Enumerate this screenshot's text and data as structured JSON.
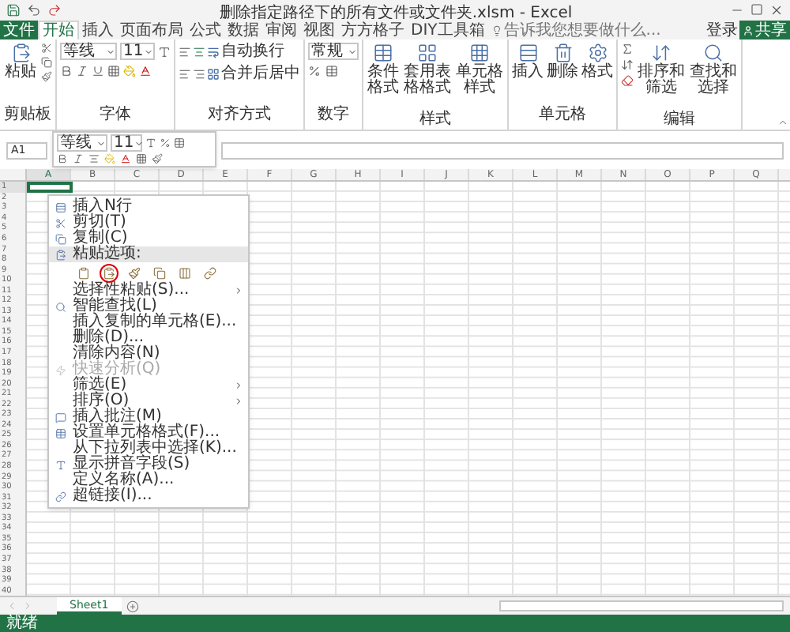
{
  "window": {
    "title": "删除指定路径下的所有文件或文件夹.xlsm - Excel"
  },
  "ribbon_tabs": [
    {
      "label": "文件",
      "kind": "file",
      "selected": false
    },
    {
      "label": "开始",
      "kind": "tab",
      "selected": true
    },
    {
      "label": "插入",
      "kind": "tab",
      "selected": false
    },
    {
      "label": "页面布局",
      "kind": "tab",
      "selected": false
    },
    {
      "label": "公式",
      "kind": "tab",
      "selected": false
    },
    {
      "label": "数据",
      "kind": "tab",
      "selected": false
    },
    {
      "label": "审阅",
      "kind": "tab",
      "selected": false
    },
    {
      "label": "视图",
      "kind": "tab",
      "selected": false
    },
    {
      "label": "方方格子",
      "kind": "tab",
      "selected": false
    },
    {
      "label": "DIY工具箱",
      "kind": "tab",
      "selected": false
    }
  ],
  "search": {
    "placeholder": "告诉我您想要做什么..."
  },
  "account": {
    "sign_in": "登录",
    "share": "共享"
  },
  "ribbon": {
    "clipboard": {
      "label": "剪贴板",
      "paste": "粘贴"
    },
    "font": {
      "label": "字体",
      "font_name": "等线",
      "font_size": "11"
    },
    "alignment": {
      "label": "对齐方式",
      "wrap_text": "自动换行",
      "merge_center": "合并后居中"
    },
    "number": {
      "label": "数字",
      "format": "常规"
    },
    "styles": {
      "label": "样式",
      "buttons": [
        "条件格式",
        "套用表格格式",
        "单元格样式"
      ]
    },
    "cells": {
      "label": "单元格",
      "buttons": [
        "插入",
        "删除",
        "格式"
      ]
    },
    "editing": {
      "label": "编辑",
      "buttons": [
        "排序和筛选",
        "查找和选择"
      ]
    }
  },
  "formula_bar": {
    "name_box": "A1"
  },
  "mini_toolbar": {
    "font_name": "等线",
    "font_size": "11"
  },
  "columns": [
    "A",
    "B",
    "C",
    "D",
    "E",
    "F",
    "G",
    "H",
    "I",
    "J",
    "K",
    "L",
    "M",
    "N",
    "O",
    "P",
    "Q"
  ],
  "rows": [
    "1",
    "2",
    "3",
    "4",
    "5",
    "6",
    "7",
    "8",
    "9",
    "10",
    "11",
    "12",
    "13",
    "14",
    "15",
    "16",
    "17",
    "18",
    "19",
    "20",
    "21",
    "22",
    "23",
    "24",
    "25",
    "26",
    "27",
    "28",
    "29",
    "30",
    "31",
    "32",
    "33",
    "34",
    "35",
    "36",
    "37",
    "38",
    "39",
    "40"
  ],
  "context_menu": {
    "items": [
      {
        "kind": "item",
        "label": "插入N行",
        "disabled": false,
        "submenu": false,
        "highlighted": false
      },
      {
        "kind": "item",
        "label": "剪切(T)",
        "disabled": false,
        "submenu": false,
        "highlighted": false
      },
      {
        "kind": "item",
        "label": "复制(C)",
        "disabled": false,
        "submenu": false,
        "highlighted": false
      },
      {
        "kind": "item",
        "label": "粘贴选项:",
        "disabled": false,
        "submenu": false,
        "highlighted": true
      },
      {
        "kind": "paste_options",
        "icons": [
          {
            "circled": false
          },
          {
            "circled": true
          },
          {
            "circled": false
          },
          {
            "circled": false
          },
          {
            "circled": false
          },
          {
            "circled": false
          }
        ]
      },
      {
        "kind": "item",
        "label": "选择性粘贴(S)...",
        "disabled": false,
        "submenu": true,
        "highlighted": false
      },
      {
        "kind": "item",
        "label": "智能查找(L)",
        "disabled": false,
        "submenu": false,
        "highlighted": false
      },
      {
        "kind": "item",
        "label": "插入复制的单元格(E)...",
        "disabled": false,
        "submenu": false,
        "highlighted": false
      },
      {
        "kind": "item",
        "label": "删除(D)...",
        "disabled": false,
        "submenu": false,
        "highlighted": false
      },
      {
        "kind": "item",
        "label": "清除内容(N)",
        "disabled": false,
        "submenu": false,
        "highlighted": false
      },
      {
        "kind": "item",
        "label": "快速分析(Q)",
        "disabled": true,
        "submenu": false,
        "highlighted": false
      },
      {
        "kind": "item",
        "label": "筛选(E)",
        "disabled": false,
        "submenu": true,
        "highlighted": false
      },
      {
        "kind": "item",
        "label": "排序(O)",
        "disabled": false,
        "submenu": true,
        "highlighted": false
      },
      {
        "kind": "item",
        "label": "插入批注(M)",
        "disabled": false,
        "submenu": false,
        "highlighted": false
      },
      {
        "kind": "item",
        "label": "设置单元格格式(F)...",
        "disabled": false,
        "submenu": false,
        "highlighted": false
      },
      {
        "kind": "item",
        "label": "从下拉列表中选择(K)...",
        "disabled": false,
        "submenu": false,
        "highlighted": false
      },
      {
        "kind": "item",
        "label": "显示拼音字段(S)",
        "disabled": false,
        "submenu": false,
        "highlighted": false
      },
      {
        "kind": "item",
        "label": "定义名称(A)...",
        "disabled": false,
        "submenu": false,
        "highlighted": false
      },
      {
        "kind": "item",
        "label": "超链接(I)...",
        "disabled": false,
        "submenu": false,
        "highlighted": false
      }
    ]
  },
  "sheet_tabs": [
    {
      "label": "Sheet1",
      "selected": true
    }
  ],
  "status_bar": {
    "text": "就绪"
  }
}
